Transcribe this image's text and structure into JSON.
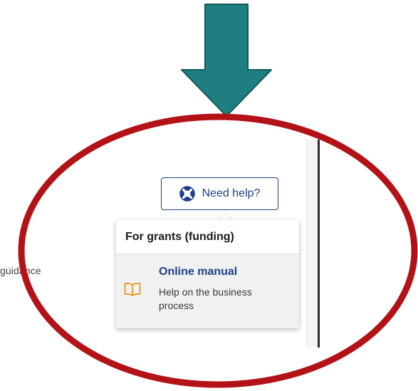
{
  "side_panel": {
    "text": "guidance"
  },
  "help_button": {
    "label": "Need help?",
    "icon": "lifebuoy-icon"
  },
  "dropdown": {
    "header": "For grants (funding)",
    "items": [
      {
        "title": "Online manual",
        "description": "Help on the business process",
        "icon": "book-icon"
      }
    ]
  },
  "annotations": {
    "arrow_color": "#1f7f80",
    "ellipse_color": "#b31217"
  },
  "colors": {
    "accent": "#1f3f8a",
    "book_icon": "#f0961e"
  }
}
